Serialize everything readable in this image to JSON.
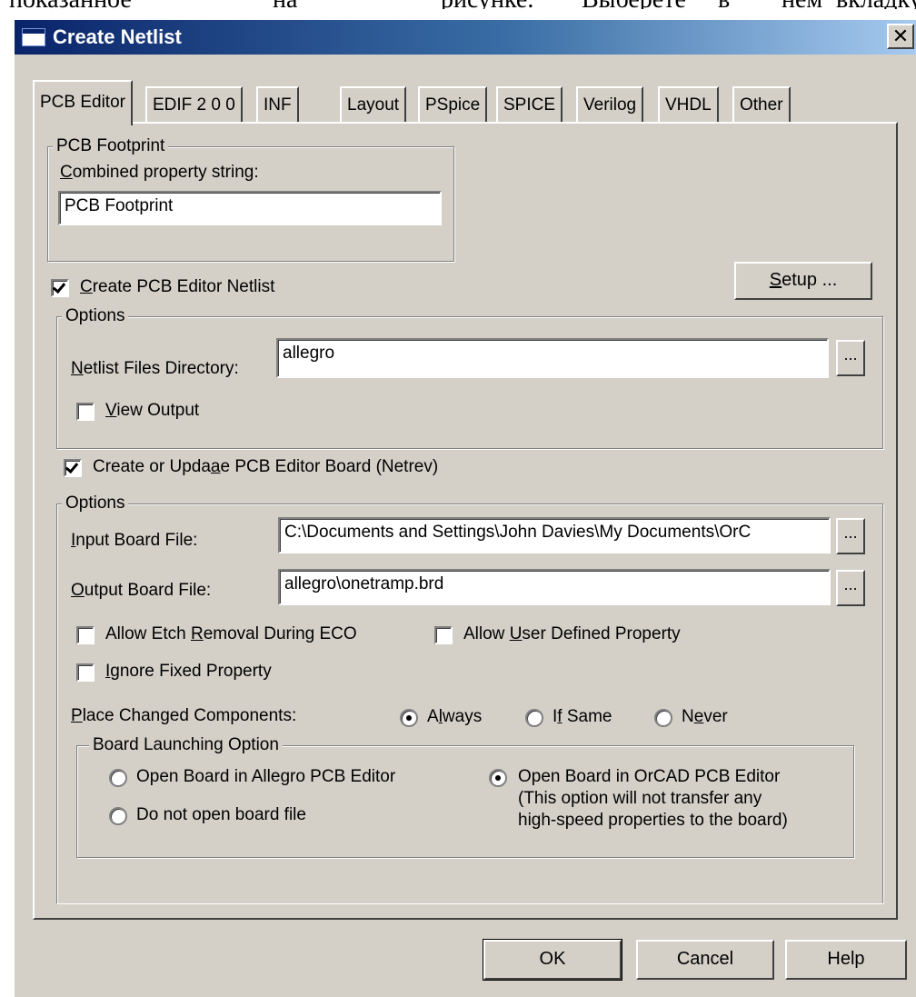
{
  "background_text": {
    "words": [
      "показанное",
      "на",
      "рисунке.",
      "Выберете",
      "в",
      "нем",
      "вкладку"
    ]
  },
  "window": {
    "title": "Create Netlist",
    "close_glyph": "✕"
  },
  "tabs": [
    {
      "label": "PCB Editor",
      "active": true
    },
    {
      "label": "EDIF 2 0 0",
      "active": false
    },
    {
      "label": "INF",
      "active": false
    },
    {
      "label": "Layout",
      "active": false
    },
    {
      "label": "PSpice",
      "active": false
    },
    {
      "label": "SPICE",
      "active": false
    },
    {
      "label": "Verilog",
      "active": false
    },
    {
      "label": "VHDL",
      "active": false
    },
    {
      "label": "Other",
      "active": false
    }
  ],
  "footprint_group": {
    "legend": "PCB Footprint",
    "field_label": "Combined property string:",
    "field_value": "PCB Footprint"
  },
  "create_netlist": {
    "label": "Create PCB Editor Netlist",
    "checked": true,
    "setup_button": "Setup ..."
  },
  "options1": {
    "legend": "Options",
    "dir_label": "Netlist Files Directory:",
    "dir_value": "allegro",
    "browse": "...",
    "view_output_label": "View Output",
    "view_output_checked": false
  },
  "create_board": {
    "label": "Create or Update PCB Editor Board (Netrev)",
    "checked": true
  },
  "options2": {
    "legend": "Options",
    "input_label": "Input Board File:",
    "input_value": "C:\\Documents and Settings\\John Davies\\My Documents\\OrC",
    "output_label": "Output Board File:",
    "output_value": "allegro\\onetramp.brd",
    "browse": "...",
    "allow_etch_label": "Allow Etch Removal During ECO",
    "allow_user_label": "Allow User Defined Property",
    "ignore_fixed_label": "Ignore Fixed Property",
    "place_changed_label": "Place Changed Components:",
    "place_options": [
      {
        "label": "Always",
        "checked": true
      },
      {
        "label": "If Same",
        "checked": false
      },
      {
        "label": "Never",
        "checked": false
      }
    ]
  },
  "launch_group": {
    "legend": "Board Launching Option",
    "opt_allegro": "Open Board in Allegro PCB Editor",
    "opt_none": "Do not open board file",
    "opt_orcad": "Open Board in OrCAD PCB Editor",
    "orcad_note_1": "(This option will not transfer any",
    "orcad_note_2": "high-speed properties to the board)",
    "selected": "orcad"
  },
  "buttons": {
    "ok": "OK",
    "cancel": "Cancel",
    "help": "Help"
  }
}
